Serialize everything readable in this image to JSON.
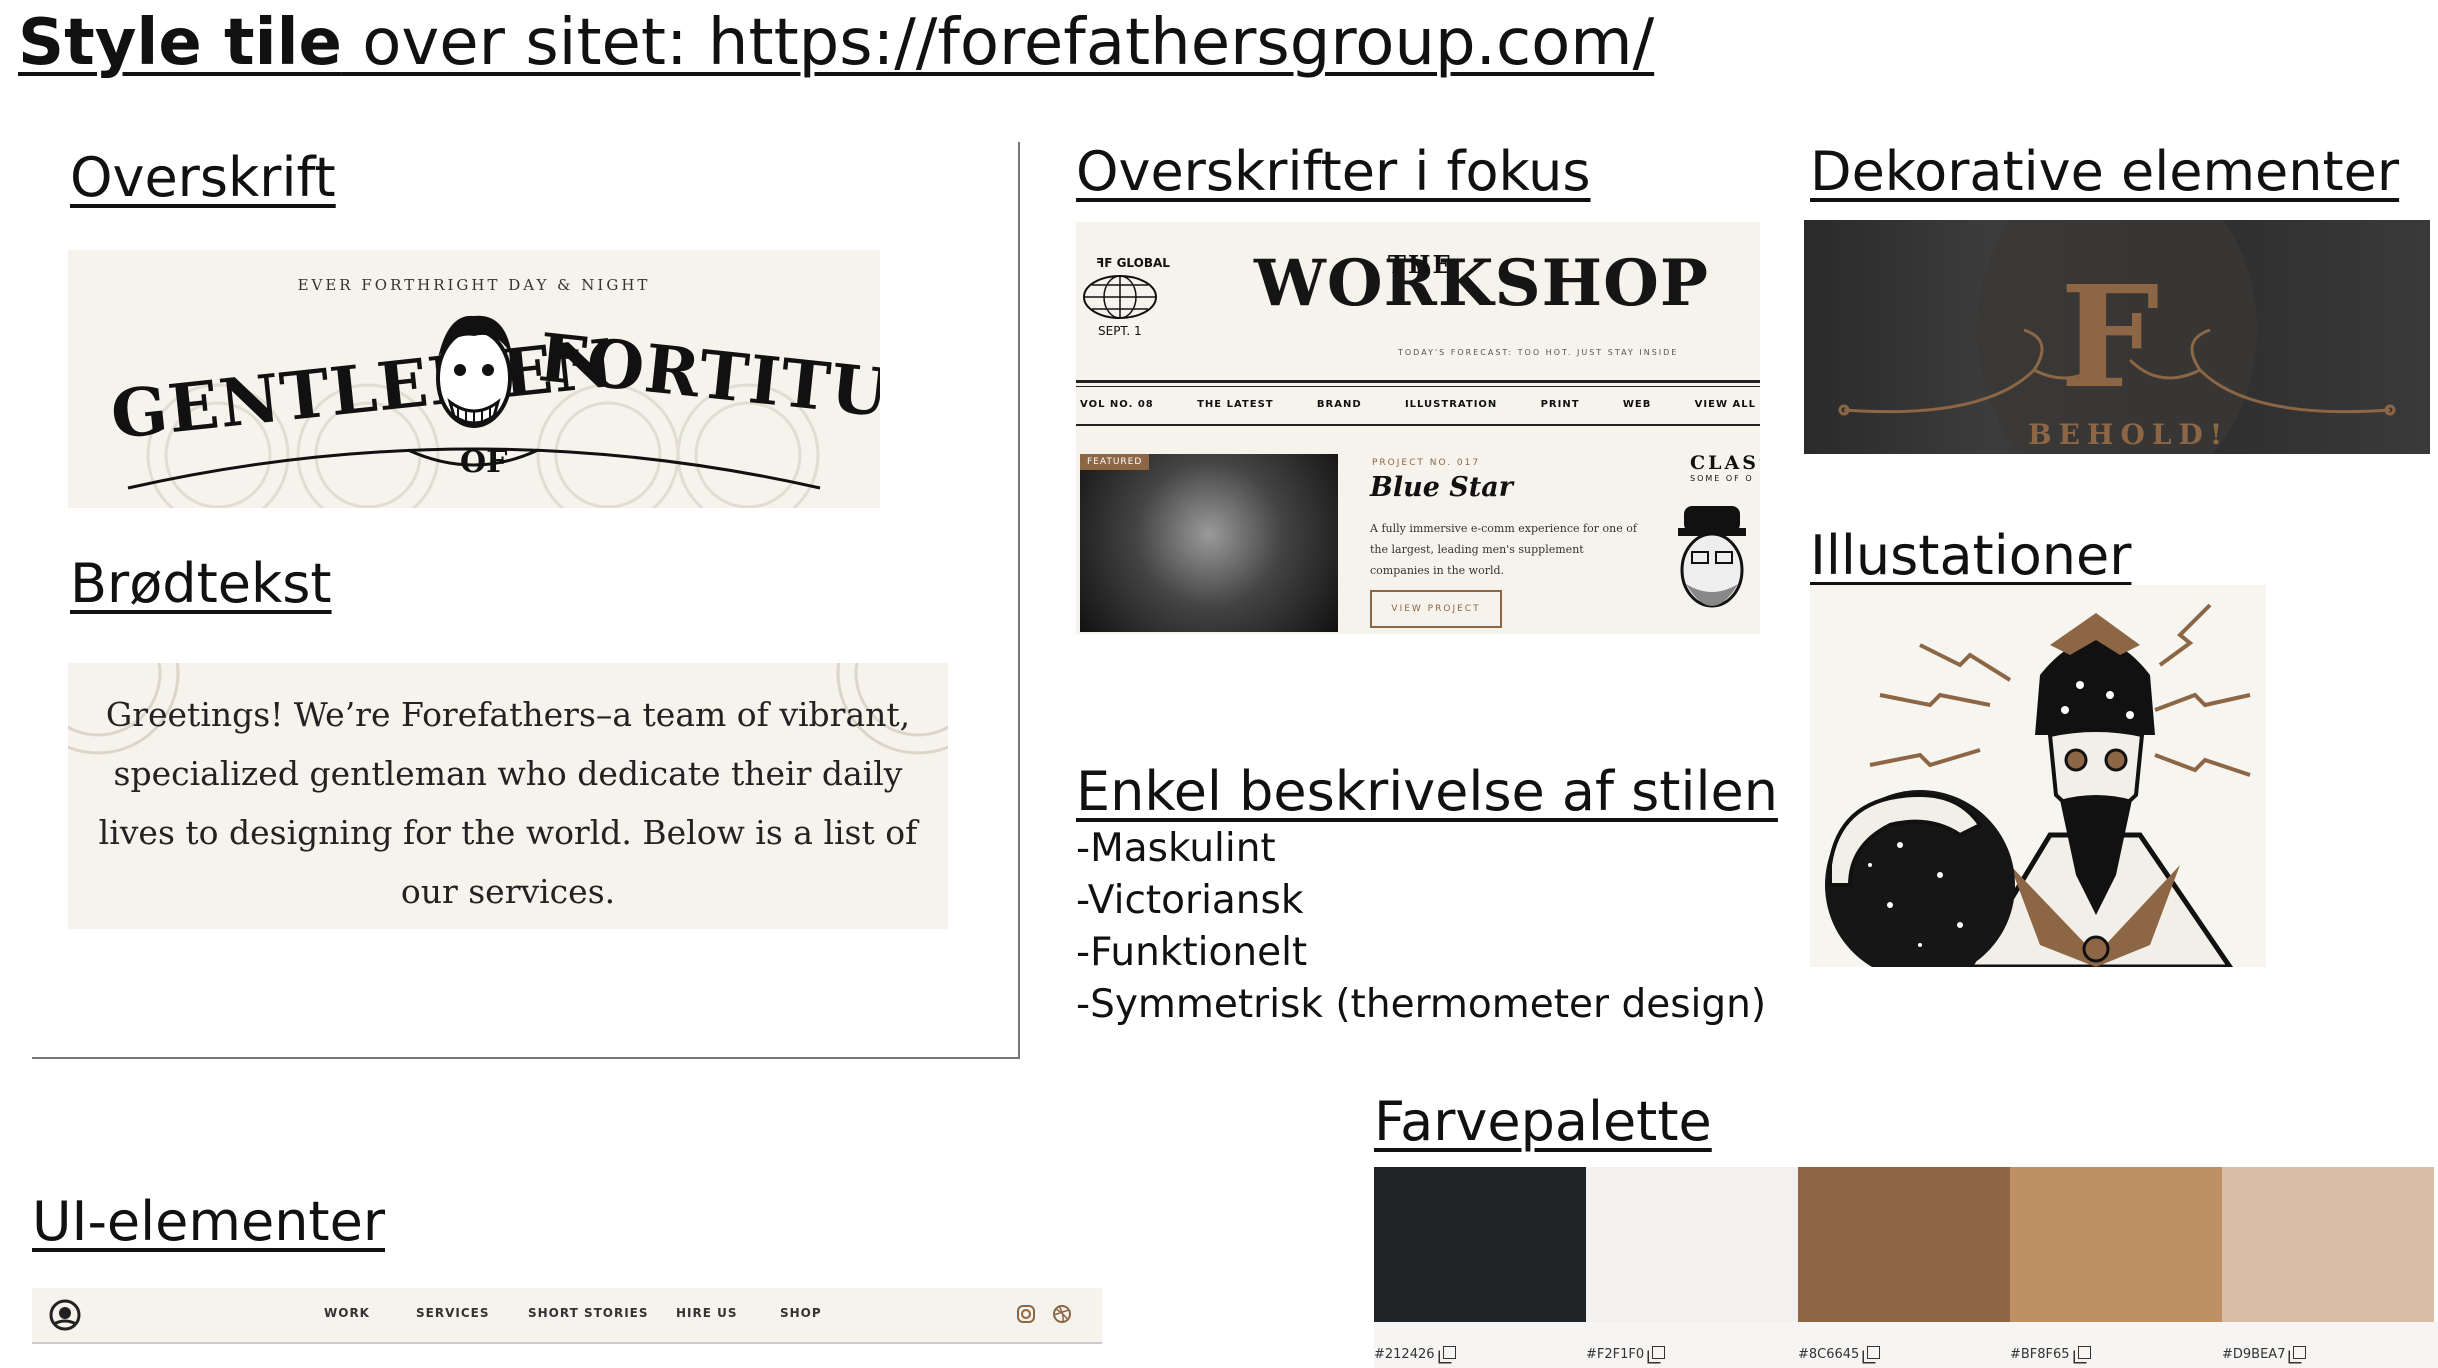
{
  "title": {
    "bold": "Style tile",
    "rest": " over sitet: https://forefathersgroup.com/"
  },
  "sections": {
    "overskrift": "Overskrift",
    "brodtekst": "Brødtekst",
    "overskrifter_fokus": "Overskrifter i fokus",
    "dekorative": "Dekorative elementer",
    "illustationer": "Illustationer",
    "beskrivelse": "Enkel beskrivelse af stilen",
    "farvepalette": "Farvepalette",
    "ui_elementer": "UI-elementer"
  },
  "headline_sample": {
    "tagline": "EVER FORTHRIGHT DAY & NIGHT",
    "word1": "GENTLEMEN",
    "word_of": "OF",
    "word2": "FORTITUDE"
  },
  "body_sample": {
    "text": "Greetings! We’re Forefathers–a team of vibrant, specialized gentleman who dedicate their daily lives to designing for the world. Below is a list of our services."
  },
  "workshop": {
    "brand": "ꟻF GLOBAL",
    "date": "SEPT. 1",
    "the": "THE",
    "title": "WORKSHOP",
    "tagline": "TODAY'S FORECAST: TOO HOT. JUST STAY INSIDE",
    "nav": [
      "VOL NO. 08",
      "THE LATEST",
      "BRAND",
      "ILLUSTRATION",
      "PRINT",
      "WEB",
      "VIEW ALL"
    ],
    "featured": "FEATURED",
    "project_no": "PROJECT NO. 017",
    "project_title": "Blue Star",
    "project_desc": "A fully immersive e-comm experience for one of the largest, leading men's supplement companies in the world.",
    "button": "VIEW PROJECT",
    "side_title": "CLASS",
    "side_sub": "SOME OF O"
  },
  "decorative": {
    "behold": "BEHOLD!"
  },
  "style_description": [
    "-Maskulint",
    "-Victoriansk",
    "-Funktionelt",
    "-Symmetrisk (thermometer design)"
  ],
  "ui_nav": {
    "items": [
      "WORK",
      "SERVICES",
      "SHORT STORIES",
      "HIRE US",
      "SHOP"
    ],
    "icons": [
      "logo-icon",
      "instagram-icon",
      "dribbble-icon"
    ]
  },
  "palette": [
    {
      "hex": "#212426",
      "label": "#212426"
    },
    {
      "hex": "#F2F1F0",
      "label": "#F2F1F0"
    },
    {
      "hex": "#8C6645",
      "label": "#8C6645"
    },
    {
      "hex": "#BF8F65",
      "label": "#BF8F65"
    },
    {
      "hex": "#D9BEA7",
      "label": "#D9BEA7"
    }
  ]
}
